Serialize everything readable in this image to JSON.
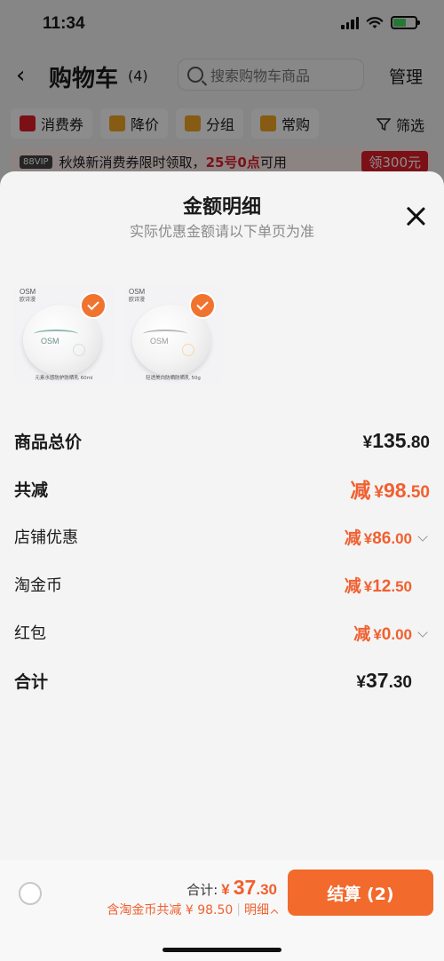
{
  "status_bar": {
    "time": "11:34"
  },
  "header": {
    "back_icon": "chevron-left-icon",
    "title": "购物车",
    "count": "(4)",
    "search_placeholder": "搜索购物车商品",
    "manage": "管理"
  },
  "filters": {
    "chips": [
      {
        "label": "消费券",
        "icon": "coupon-icon",
        "color": "#e0202a"
      },
      {
        "label": "降价",
        "icon": "price-down-icon",
        "color": "#f5a623"
      },
      {
        "label": "分组",
        "icon": "folder-icon",
        "color": "#f5a623"
      },
      {
        "label": "常购",
        "icon": "cart-icon",
        "color": "#f5a623"
      }
    ],
    "filter_label": "筛选"
  },
  "promo": {
    "badge": "88VIP",
    "text_before": "秋焕新消费券限时领取，",
    "text_highlight": "25号0点",
    "text_after": "可用",
    "button": "领300元"
  },
  "sheet": {
    "title": "金额明细",
    "subtitle": "实际优惠金额请以下单页为准",
    "products": [
      {
        "brand_line1": "OSM",
        "brand_line2": "欧诗漫",
        "caption": "元素水感防护防晒乳 60ml",
        "selected": true
      },
      {
        "brand_line1": "OSM",
        "brand_line2": "欧诗漫",
        "caption": "轻透美白防晒防晒乳 50g",
        "selected": true
      }
    ],
    "rows": {
      "goods_total": {
        "label": "商品总价",
        "currency": "¥",
        "integer": "135",
        "decimal": ".80"
      },
      "total_reduction": {
        "label": "共减",
        "prefix": "减",
        "currency": "¥",
        "integer": "98",
        "decimal": ".50"
      },
      "store_discount": {
        "label": "店铺优惠",
        "prefix": "减",
        "currency": "¥",
        "integer": "86",
        "decimal": ".00"
      },
      "taojinbi": {
        "label": "淘金币",
        "prefix": "减",
        "currency": "¥",
        "integer": "12",
        "decimal": ".50"
      },
      "red_packet": {
        "label": "红包",
        "prefix": "减",
        "currency": "¥",
        "integer": "0",
        "decimal": ".00"
      },
      "grand_total": {
        "label": "合计",
        "currency": "¥",
        "integer": "37",
        "decimal": ".30"
      }
    }
  },
  "bottom_bar": {
    "total_label": "合计:",
    "currency": "¥",
    "total_integer": "37",
    "total_decimal": ".30",
    "savings_text": "含淘金币共减 ¥ 98.50",
    "separator": "|",
    "detail_label": "明细",
    "checkout_label": "结算 (2)"
  },
  "colors": {
    "accent_orange": "#f26a2c",
    "discount_orange": "#f06030",
    "promo_red": "#e0202a"
  }
}
